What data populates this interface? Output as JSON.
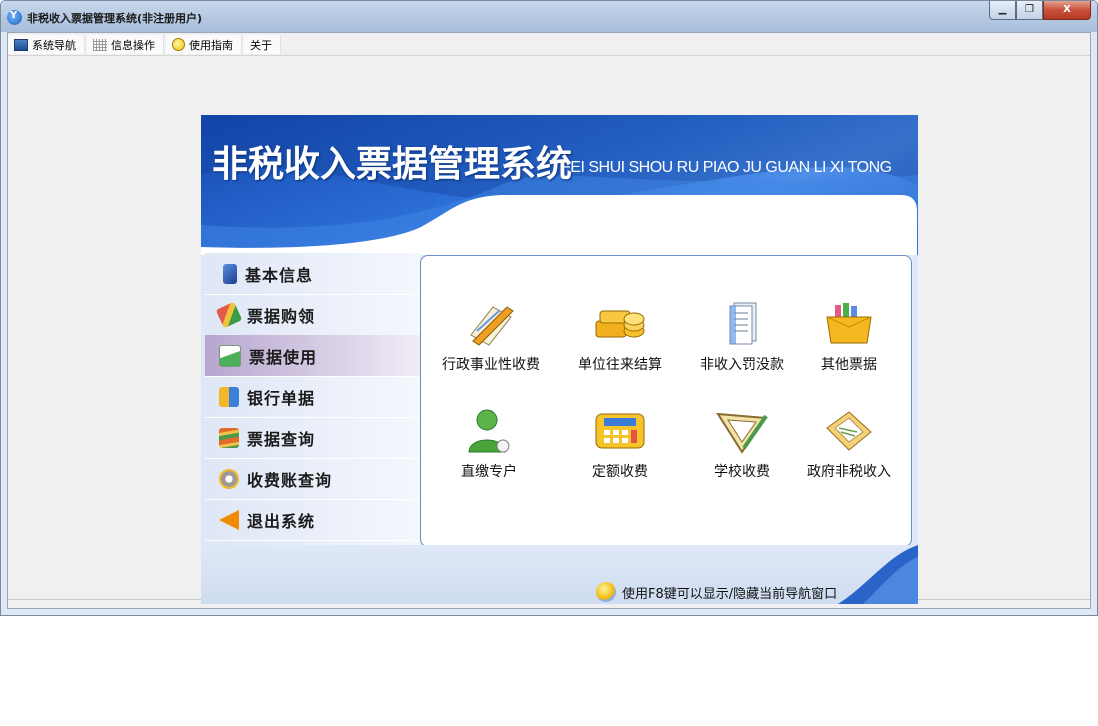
{
  "window": {
    "title": "非税收入票据管理系统(非注册用户)",
    "min_label": "▁",
    "max_label": "❐",
    "close_label": "X"
  },
  "menu": [
    {
      "label": "系统导航",
      "icon": "nav-window-icon"
    },
    {
      "label": "信息操作",
      "icon": "grid-icon"
    },
    {
      "label": "使用指南",
      "icon": "help-icon"
    },
    {
      "label": "关于",
      "icon": ""
    }
  ],
  "banner": {
    "title": "非税收入票据管理系统",
    "subtitle": "FEI SHUI SHOU RU PIAO JU GUAN LI XI TONG"
  },
  "sidebar": {
    "items": [
      {
        "label": "基本信息",
        "icon": "book-icon",
        "color": "#2b5fb0"
      },
      {
        "label": "票据购领",
        "icon": "pencil-ribbon-icon",
        "color": "#d24b3c"
      },
      {
        "label": "票据使用",
        "icon": "ticket-use-icon",
        "color": "#3aa04a"
      },
      {
        "label": "银行单据",
        "icon": "bank-slip-icon",
        "color": "#e2a21c"
      },
      {
        "label": "票据查询",
        "icon": "stacked-books-icon",
        "color": "#e07a20"
      },
      {
        "label": "收费账查询",
        "icon": "gears-icon",
        "color": "#8a8a8a"
      },
      {
        "label": "退出系统",
        "icon": "exit-arrow-icon",
        "color": "#f08a00"
      }
    ],
    "active_index": 2
  },
  "tiles": [
    {
      "label": "行政事业性收费",
      "icon": "notepad-pencil-icon"
    },
    {
      "label": "单位往来结算",
      "icon": "coins-icon"
    },
    {
      "label": "非收入罚没款",
      "icon": "documents-icon"
    },
    {
      "label": "其他票据",
      "icon": "folder-box-icon"
    },
    {
      "label": "直缴专户",
      "icon": "user-icon"
    },
    {
      "label": "定额收费",
      "icon": "calculator-icon"
    },
    {
      "label": "学校收费",
      "icon": "triangle-ruler-icon"
    },
    {
      "label": "政府非税收入",
      "icon": "ledger-icon"
    }
  ],
  "footer": {
    "tip": "使用F8键可以显示/隐藏当前导航窗口"
  },
  "colors": {
    "banner_blue": "#1f5cc2",
    "active_item": "#b7a6cf",
    "content_border": "#6a8fc8"
  }
}
